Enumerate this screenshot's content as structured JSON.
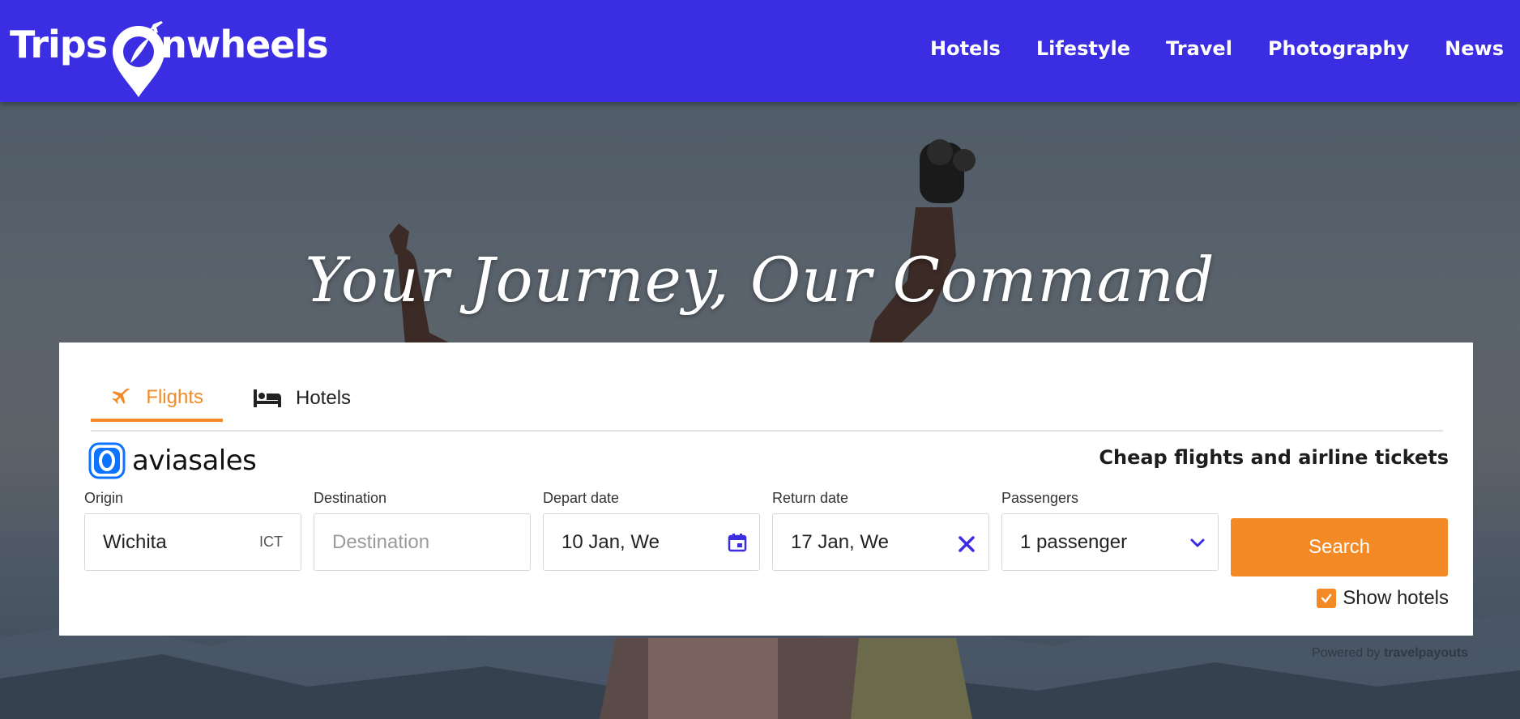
{
  "header": {
    "logo_text": "Trips nwheels",
    "nav": [
      "Hotels",
      "Lifestyle",
      "Travel",
      "Photography",
      "News"
    ]
  },
  "hero": {
    "title": "Your Journey, Our Command"
  },
  "widget": {
    "tabs": [
      {
        "label": "Flights",
        "icon": "plane-icon",
        "active": true
      },
      {
        "label": "Hotels",
        "icon": "bed-icon",
        "active": false
      }
    ],
    "brand": "aviasales",
    "tagline": "Cheap flights and airline tickets",
    "fields": {
      "origin": {
        "label": "Origin",
        "value": "Wichita",
        "code": "ICT"
      },
      "destination": {
        "label": "Destination",
        "placeholder": "Destination"
      },
      "depart": {
        "label": "Depart date",
        "value": "10 Jan, We"
      },
      "return": {
        "label": "Return date",
        "value": "17 Jan, We"
      },
      "passengers": {
        "label": "Passengers",
        "value": "1 passenger"
      }
    },
    "search_label": "Search",
    "show_hotels_label": "Show hotels",
    "show_hotels_checked": true,
    "powered_prefix": "Powered by",
    "powered_brand": "travelpayouts"
  },
  "colors": {
    "header_bg": "#3b2ee2",
    "accent": "#f38a25",
    "icon_blue": "#3b2ee2"
  }
}
